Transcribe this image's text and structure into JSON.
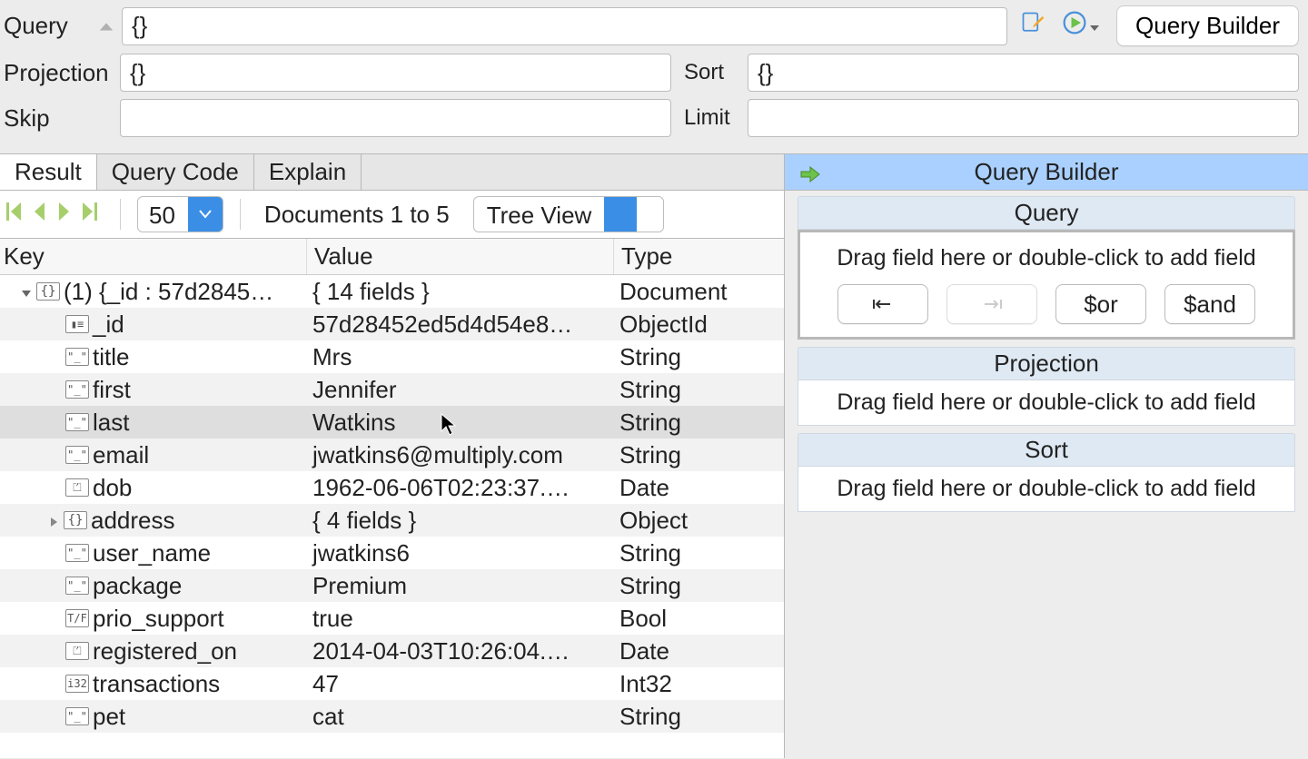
{
  "query_bar": {
    "query_label": "Query",
    "query_value": "{}",
    "projection_label": "Projection",
    "projection_value": "{}",
    "sort_label": "Sort",
    "sort_value": "{}",
    "skip_label": "Skip",
    "skip_value": "",
    "limit_label": "Limit",
    "limit_value": "",
    "query_builder_btn": "Query Builder"
  },
  "tabs": {
    "result": "Result",
    "query_code": "Query Code",
    "explain": "Explain"
  },
  "controls": {
    "page_size": "50",
    "doc_count": "Documents 1 to 5",
    "view_mode": "Tree View"
  },
  "columns": {
    "key": "Key",
    "value": "Value",
    "type": "Type"
  },
  "rows": [
    {
      "indent": "root",
      "icon": "obj",
      "key": "(1) {_id : 57d2845…",
      "value": "{ 14 fields }",
      "type": "Document",
      "expanded": true
    },
    {
      "indent": "child",
      "icon": "id",
      "key": "_id",
      "value": "57d28452ed5d4d54e8…",
      "type": "ObjectId"
    },
    {
      "indent": "child",
      "icon": "str",
      "key": "title",
      "value": "Mrs",
      "type": "String"
    },
    {
      "indent": "child",
      "icon": "str",
      "key": "first",
      "value": "Jennifer",
      "type": "String"
    },
    {
      "indent": "child",
      "icon": "str",
      "key": "last",
      "value": "Watkins",
      "type": "String",
      "highlight": true
    },
    {
      "indent": "child",
      "icon": "str",
      "key": "email",
      "value": "jwatkins6@multiply.com",
      "type": "String"
    },
    {
      "indent": "child",
      "icon": "date",
      "key": "dob",
      "value": "1962-06-06T02:23:37.…",
      "type": "Date"
    },
    {
      "indent": "expand",
      "icon": "obj",
      "key": "address",
      "value": "{ 4 fields }",
      "type": "Object"
    },
    {
      "indent": "child",
      "icon": "str",
      "key": "user_name",
      "value": "jwatkins6",
      "type": "String"
    },
    {
      "indent": "child",
      "icon": "str",
      "key": "package",
      "value": "Premium",
      "type": "String"
    },
    {
      "indent": "child",
      "icon": "bool",
      "key": "prio_support",
      "value": "true",
      "type": "Bool"
    },
    {
      "indent": "child",
      "icon": "date",
      "key": "registered_on",
      "value": "2014-04-03T10:26:04.…",
      "type": "Date"
    },
    {
      "indent": "child",
      "icon": "int",
      "key": "transactions",
      "value": "47",
      "type": "Int32"
    },
    {
      "indent": "child",
      "icon": "str",
      "key": "pet",
      "value": "cat",
      "type": "String"
    }
  ],
  "qb": {
    "header": "Query Builder",
    "query_title": "Query",
    "drag_hint": "Drag field here or double-click to add field",
    "btn_or": "$or",
    "btn_and": "$and",
    "projection_title": "Projection",
    "sort_title": "Sort"
  },
  "icon_glyphs": {
    "str": "\"_\"",
    "id": "▮≡",
    "date": "⏍",
    "bool": "T/F",
    "int": "i32",
    "obj": "{}"
  }
}
